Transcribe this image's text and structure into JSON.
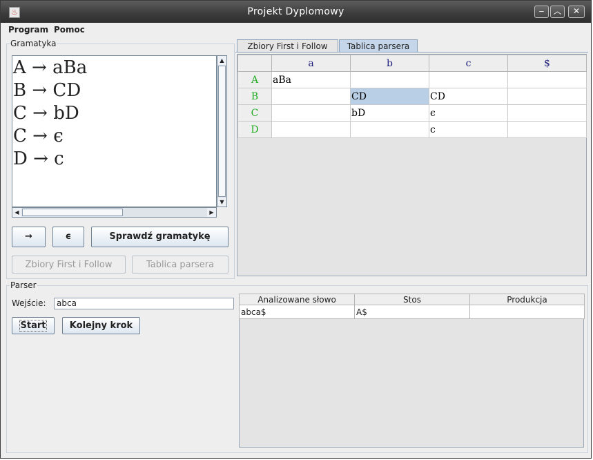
{
  "window": {
    "title": "Projekt Dyplomowy",
    "app_icon": "java-icon"
  },
  "menu": {
    "items": [
      "Program",
      "Pomoc"
    ]
  },
  "grammar": {
    "group_title": "Gramatyka",
    "lines": [
      "A → aBa",
      "B → CD",
      "C → bD",
      "C → ϵ",
      "D → c"
    ]
  },
  "buttons": {
    "arrow": "→",
    "epsilon": "ϵ",
    "check": "Sprawdź gramatykę",
    "first_follow": "Zbiory First i Follow",
    "parse_table": "Tablica parsera",
    "start": "Start",
    "next_step": "Kolejny krok"
  },
  "tabs": [
    {
      "label": "Zbiory First i Follow",
      "active": false
    },
    {
      "label": "Tablica parsera",
      "active": true
    }
  ],
  "parse_table": {
    "columns": [
      "a",
      "b",
      "c",
      "$"
    ],
    "rows": [
      {
        "nt": "A",
        "cells": [
          "aBa",
          "",
          "",
          ""
        ]
      },
      {
        "nt": "B",
        "cells": [
          "",
          "CD",
          "CD",
          ""
        ]
      },
      {
        "nt": "C",
        "cells": [
          "",
          "bD",
          "ϵ",
          ""
        ]
      },
      {
        "nt": "D",
        "cells": [
          "",
          "",
          "c",
          ""
        ]
      }
    ],
    "selected": "B:b"
  },
  "parser": {
    "group_title": "Parser",
    "input_label": "Wejście:",
    "input_value": "abca",
    "trace": {
      "columns": [
        "Analizowane słowo",
        "Stos",
        "Produkcja"
      ],
      "rows": [
        [
          "abca$",
          "A$",
          ""
        ]
      ]
    }
  }
}
